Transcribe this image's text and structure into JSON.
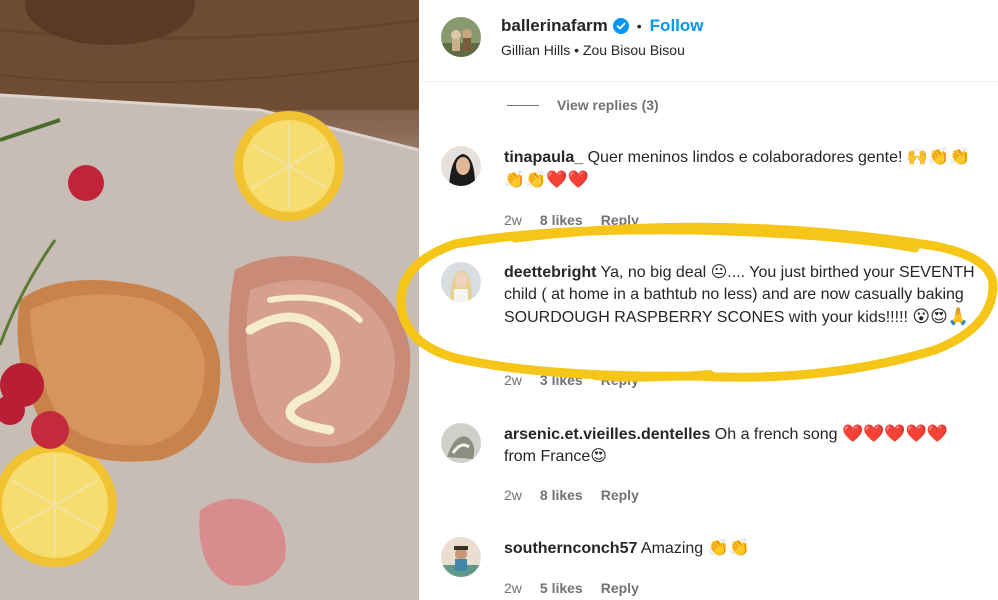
{
  "post": {
    "username": "ballerinafarm",
    "verified_icon": "verified-badge-icon",
    "separator": "•",
    "follow_label": "Follow",
    "audio_line": "Gillian Hills • Zou Bisou Bisou"
  },
  "view_replies_label": "View replies (3)",
  "colors": {
    "follow": "#0095f6",
    "meta_text": "#737373",
    "annotation": "#f5c518"
  },
  "comments": [
    {
      "username": "tinapaula_",
      "text": "Quer meninos lindos e colaboradores gente!",
      "emojis": "🙌👏👏👏👏❤️❤️",
      "age": "2w",
      "likes": "8 likes",
      "reply": "Reply"
    },
    {
      "username": "deettebright",
      "text": "Ya, no big deal 😐.... You just birthed your SEVENTH child ( at home in a bathtub no less) and are now casually baking SOURDOUGH RASPBERRY SCONES with your kids!!!!!",
      "emojis": "😮😍🙏",
      "age": "2w",
      "likes": "3 likes",
      "reply": "Reply"
    },
    {
      "username": "arsenic.et.vieilles.dentelles",
      "text": "Oh a french song",
      "emojis": "❤️❤️❤️❤️❤️",
      "tail": "from France😍",
      "age": "2w",
      "likes": "8 likes",
      "reply": "Reply"
    },
    {
      "username": "southernconch57",
      "text": "Amazing",
      "emojis": "👏👏",
      "age": "2w",
      "likes": "5 likes",
      "reply": "Reply"
    }
  ]
}
